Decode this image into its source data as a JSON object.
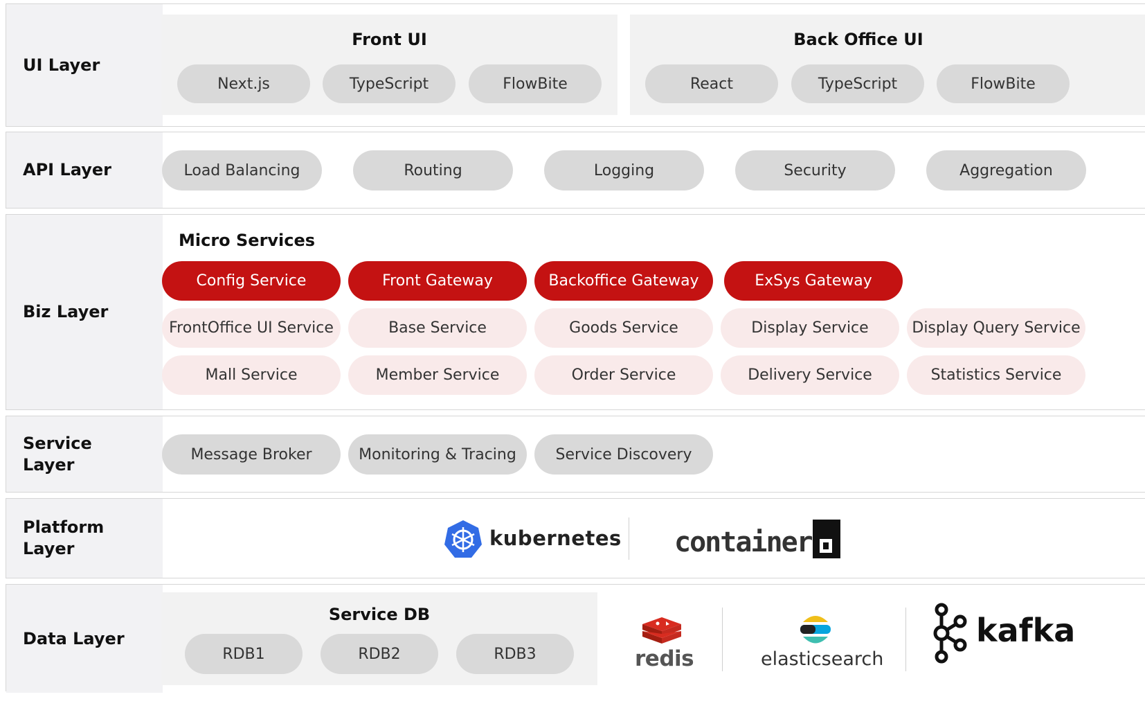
{
  "layers": {
    "ui": {
      "label": "UI Layer",
      "front": {
        "title": "Front UI",
        "items": [
          "Next.js",
          "TypeScript",
          "FlowBite"
        ]
      },
      "back": {
        "title": "Back Office UI",
        "items": [
          "React",
          "TypeScript",
          "FlowBite"
        ]
      }
    },
    "api": {
      "label": "API Layer",
      "items": [
        "Load Balancing",
        "Routing",
        "Logging",
        "Security",
        "Aggregation"
      ]
    },
    "biz": {
      "label": "Biz Layer",
      "title": "Micro Services",
      "gateways": [
        "Config Service",
        "Front Gateway",
        "Backoffice Gateway",
        "ExSys Gateway"
      ],
      "row2": [
        "FrontOffice UI Service",
        "Base Service",
        "Goods Service",
        "Display Service",
        "Display Query Service"
      ],
      "row3": [
        "Mall Service",
        "Member Service",
        "Order Service",
        "Delivery Service",
        "Statistics Service"
      ]
    },
    "service": {
      "label": "Service Layer",
      "items": [
        "Message Broker",
        "Monitoring & Tracing",
        "Service Discovery"
      ]
    },
    "platform": {
      "label": "Platform Layer",
      "logos": [
        "kubernetes",
        "containerd"
      ]
    },
    "data": {
      "label": "Data Layer",
      "db_title": "Service DB",
      "dbs": [
        "RDB1",
        "RDB2",
        "RDB3"
      ],
      "logos": [
        "redis",
        "elasticsearch",
        "kafka"
      ]
    }
  },
  "colors": {
    "label_bg": "#f2f2f4",
    "pill_gray": "#d9d9d9",
    "gateway_red": "#c41212",
    "service_pink": "#f9eaea"
  }
}
